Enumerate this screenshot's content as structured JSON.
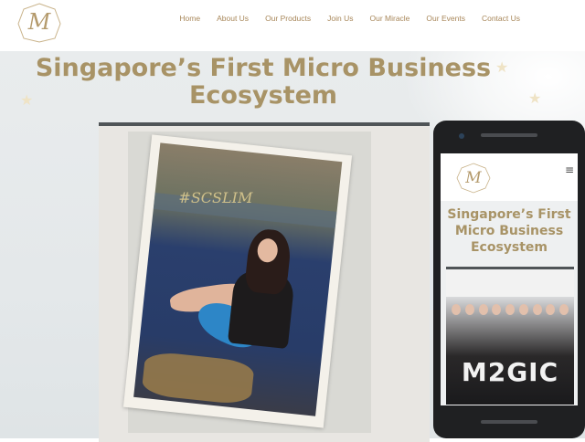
{
  "nav": {
    "items": [
      "Home",
      "About Us",
      "Our Products",
      "Join Us",
      "Our Miracle",
      "Our Events",
      "Contact Us"
    ]
  },
  "hero": {
    "title_line1": "Singapore’s First Micro Business",
    "title_line2": "Ecosystem",
    "photo_hashtag": "#SCSLIM"
  },
  "mobile": {
    "title_line1": "Singapore’s First",
    "title_line2": "Micro Business",
    "title_line3": "Ecosystem",
    "photo_brand": "M2GIC",
    "menu_icon": "hamburger-menu-icon"
  },
  "colors": {
    "accent_gold": "#a89366",
    "nav_text": "#a8875a",
    "phone_body": "#1f2022"
  }
}
